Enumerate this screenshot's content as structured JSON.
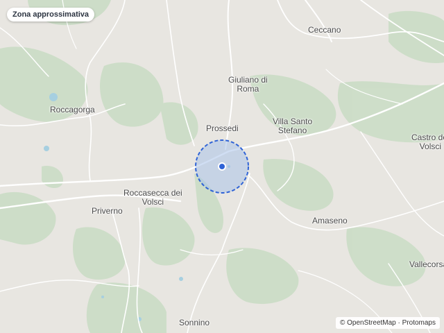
{
  "badge": {
    "label": "Zona approssimativa"
  },
  "places": [
    {
      "key": "ceccano",
      "label": "Ceccano"
    },
    {
      "key": "giuliano",
      "label": "Giuliano di\nRoma"
    },
    {
      "key": "roccagorga",
      "label": "Roccagorga"
    },
    {
      "key": "prossedi",
      "label": "Prossedi"
    },
    {
      "key": "villa-santo-stefano",
      "label": "Villa Santo\nStefano"
    },
    {
      "key": "castro",
      "label": "Castro dei\nVolsci"
    },
    {
      "key": "roccasecca",
      "label": "Roccasecca dei\nVolsci"
    },
    {
      "key": "priverno",
      "label": "Priverno"
    },
    {
      "key": "amaseno",
      "label": "Amaseno"
    },
    {
      "key": "vallecorsa",
      "label": "Vallecorsa"
    },
    {
      "key": "sonnino",
      "label": "Sonnino"
    }
  ],
  "attribution": {
    "prefix": "© ",
    "osm": "OpenStreetMap",
    "sep": " · ",
    "tiles": "Protomaps"
  },
  "colors": {
    "land": "#e8e6e1",
    "green": "#c9dcc4",
    "road": "#ffffff",
    "accuracy_fill": "#a9c2ea",
    "accuracy_stroke": "#2f63d6",
    "marker": "#2f63d6"
  }
}
